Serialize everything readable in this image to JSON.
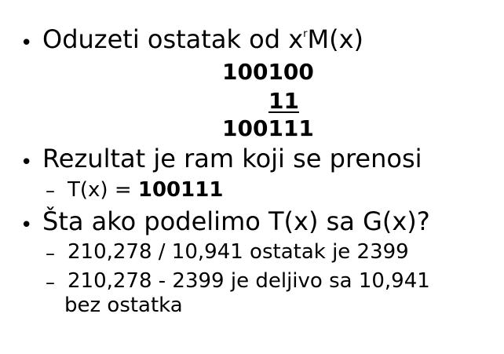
{
  "bullets": [
    {
      "marker": "•",
      "text_before_sup": "Oduzeti ostatak od x",
      "sup": "r",
      "text_after_sup": "M(x)"
    },
    {
      "marker": "•",
      "text": "Rezultat je ram koji se prenosi"
    },
    {
      "marker": "•",
      "text": "Šta ako podelimo T(x) sa G(x)?"
    }
  ],
  "calculation": {
    "row1": "100100",
    "row2": "11",
    "row3": "100111"
  },
  "sub_items": {
    "t_line": {
      "marker": "–",
      "prefix": "T(x) = ",
      "value": "100111"
    },
    "item1": {
      "marker": "–",
      "text": "210,278 / 10,941 ostatak je 2399"
    },
    "item2": {
      "marker": "–",
      "line1": "210,278 - 2399 je deljivo sa 10,941",
      "line2": "bez ostatka"
    }
  }
}
